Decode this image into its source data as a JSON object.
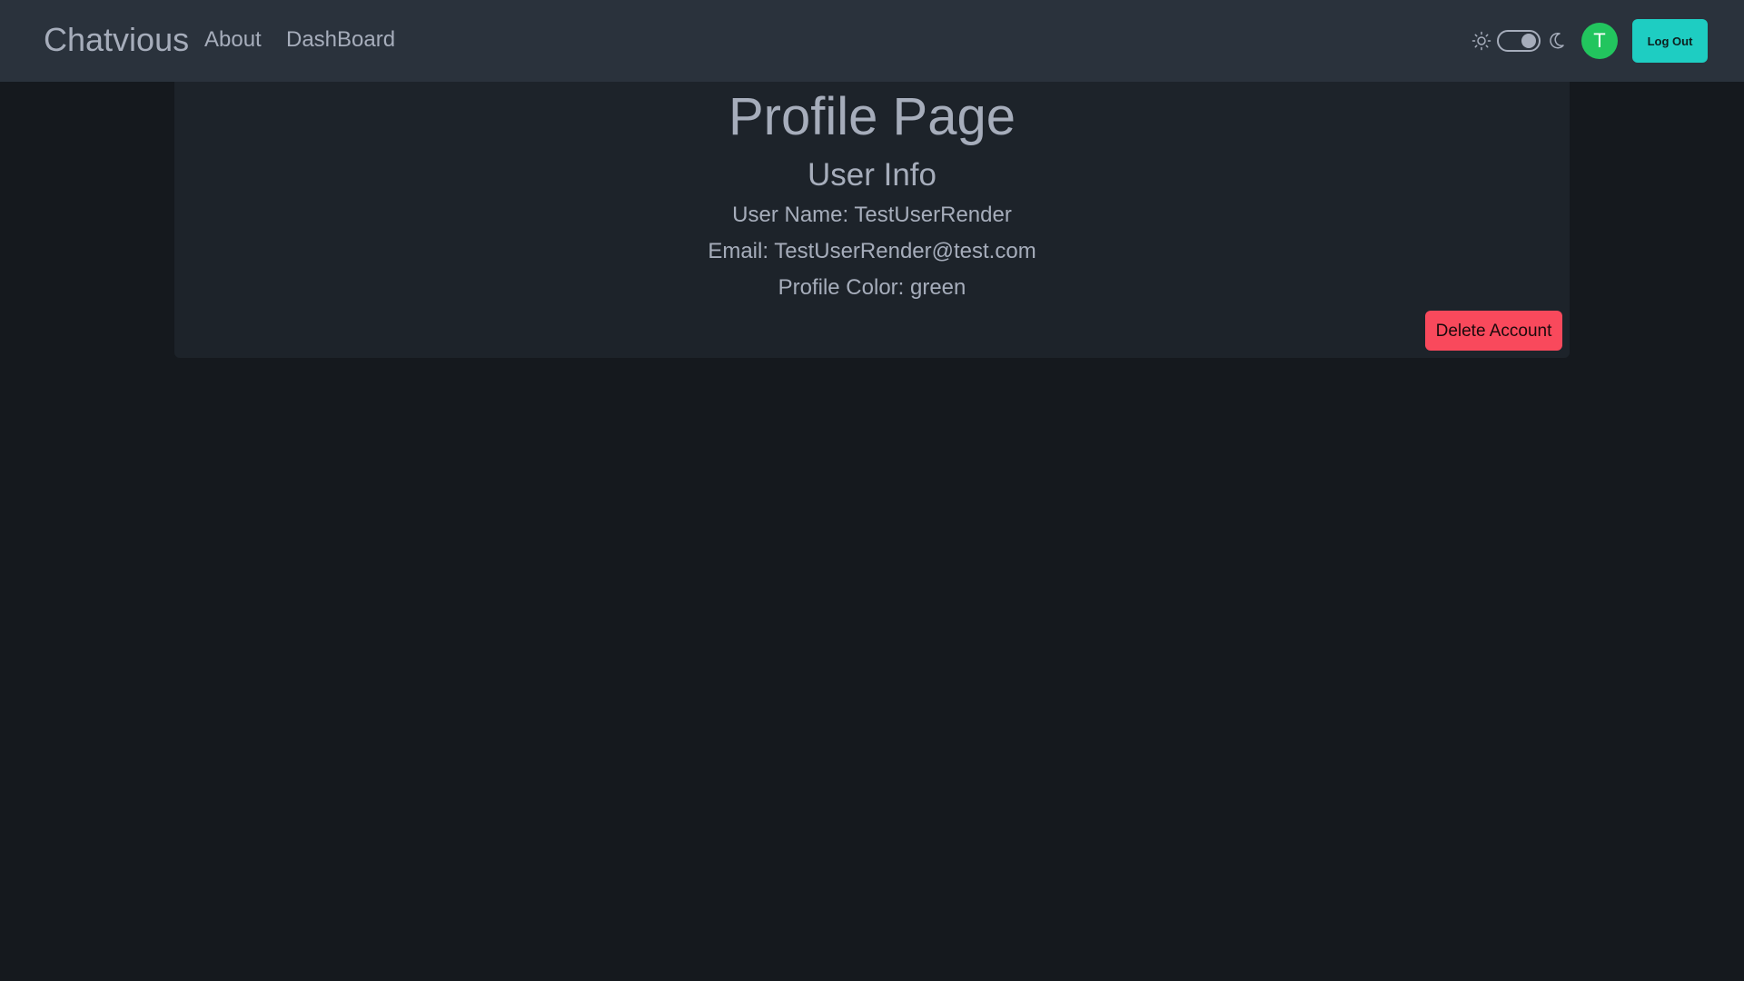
{
  "navbar": {
    "brand": "Chatvious",
    "links": [
      {
        "label": "About"
      },
      {
        "label": "DashBoard"
      }
    ],
    "theme_toggle": {
      "light_icon": "sun-icon",
      "dark_icon": "moon-icon",
      "state": "dark"
    },
    "avatar": {
      "initial": "T",
      "color": "#22c55e"
    },
    "logout_label": "Log Out"
  },
  "profile": {
    "page_title": "Profile Page",
    "section_title": "User Info",
    "username_line": "User Name: TestUserRender",
    "email_line": "Email: TestUserRender@test.com",
    "color_line": "Profile Color: green",
    "delete_label": "Delete Account"
  },
  "colors": {
    "background": "#15191e",
    "navbar": "#2a323c",
    "card": "#1d232a",
    "text": "#a6adbb",
    "accent": "#1ecdc2",
    "danger": "#f9495c",
    "avatar": "#22c55e"
  }
}
